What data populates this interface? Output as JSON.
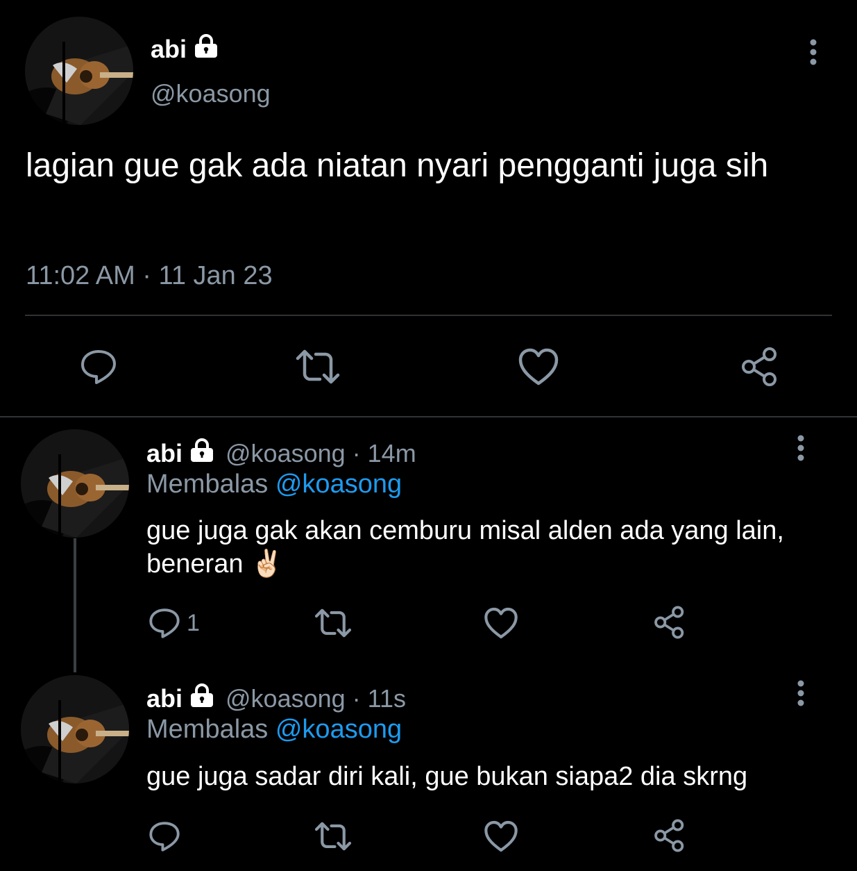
{
  "main_tweet": {
    "name": "abi",
    "handle": "@koasong",
    "text": "lagian gue gak ada niatan nyari pengganti juga sih",
    "timestamp": "11:02 AM · 11 Jan 23"
  },
  "replies": [
    {
      "name": "abi",
      "handle": "@koasong",
      "time": "· 14m",
      "replying_label": "Membalas",
      "replying_to": "@koasong",
      "text": "gue juga gak akan cemburu misal alden ada yang lain, beneran ✌🏻",
      "reply_count": "1"
    },
    {
      "name": "abi",
      "handle": "@koasong",
      "time": "· 11s",
      "replying_label": "Membalas",
      "replying_to": "@koasong",
      "text": "gue juga sadar diri kali, gue bukan siapa2 dia skrng",
      "reply_count": ""
    }
  ],
  "icons": {
    "lock": "lock-icon",
    "more": "more-vertical-icon",
    "reply": "reply-bubble-icon",
    "retweet": "retweet-icon",
    "like": "heart-icon",
    "share": "share-icon"
  },
  "colors": {
    "background": "#000000",
    "text": "#ffffff",
    "muted": "#8b98a5",
    "link": "#1d9bf0",
    "divider": "#2f3336"
  }
}
